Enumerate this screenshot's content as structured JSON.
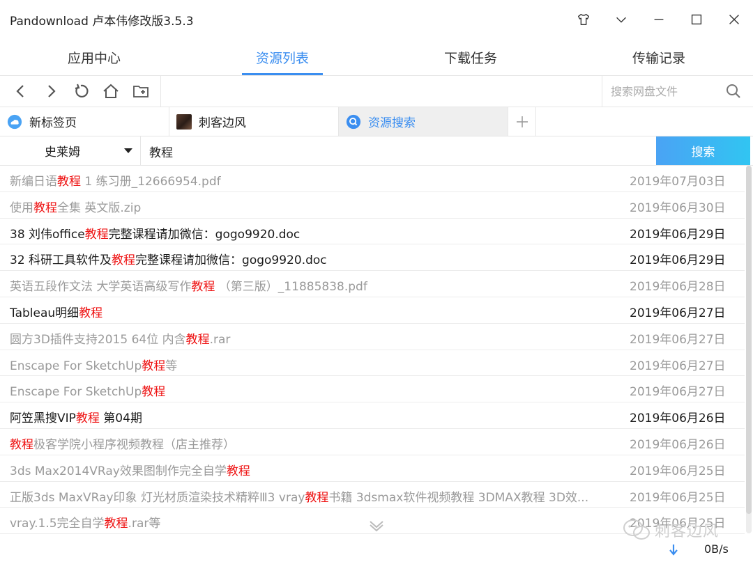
{
  "app": {
    "title": "Pandownload 卢本伟修改版3.5.3"
  },
  "main_nav": {
    "tabs": [
      {
        "label": "应用中心"
      },
      {
        "label": "资源列表"
      },
      {
        "label": "下载任务"
      },
      {
        "label": "传输记录"
      }
    ],
    "active_tab": "资源列表"
  },
  "toolbar": {
    "buttons": [
      "back-icon",
      "forward-icon",
      "refresh-icon",
      "home-icon",
      "new-folder-icon"
    ],
    "search_placeholder": "搜索网盘文件"
  },
  "browser_tabs": [
    {
      "label": "新标签页",
      "icon": "cloud-icon"
    },
    {
      "label": "刺客边风",
      "icon": "avatar"
    },
    {
      "label": "资源搜索",
      "icon": "search-icon",
      "active": true
    }
  ],
  "search_bar": {
    "source": "史莱姆",
    "keyword": "教程",
    "button_label": "搜索"
  },
  "results": [
    {
      "pre": "新编日语",
      "hl": "教程",
      "post": " 1  练习册_12666954.pdf",
      "date": "2019年07月03日",
      "tone": "gray"
    },
    {
      "pre": "使用",
      "hl": "教程",
      "post": "全集 英文版.zip",
      "date": "2019年06月30日",
      "tone": "gray"
    },
    {
      "pre": "38   刘伟office",
      "hl": "教程",
      "post": "完整课程请加微信：gogo9920.doc",
      "date": "2019年06月29日",
      "tone": "dark"
    },
    {
      "pre": "32   科研工具软件及",
      "hl": "教程",
      "post": "完整课程请加微信：gogo9920.doc",
      "date": "2019年06月29日",
      "tone": "dark"
    },
    {
      "pre": "英语五段作文法  大学英语高级写作",
      "hl": "教程",
      "post": " （第三版）_11885838.pdf",
      "date": "2019年06月28日",
      "tone": "gray"
    },
    {
      "pre": "Tableau明细",
      "hl": "教程",
      "post": "",
      "date": "2019年06月27日",
      "tone": "dark"
    },
    {
      "pre": "圆方3D插件支持2015 64位 内含",
      "hl": "教程",
      "post": ".rar",
      "date": "2019年06月27日",
      "tone": "gray"
    },
    {
      "pre": "Enscape For SketchUp",
      "hl": "教程",
      "post": "等",
      "date": "2019年06月27日",
      "tone": "gray"
    },
    {
      "pre": "Enscape For SketchUp",
      "hl": "教程",
      "post": "",
      "date": "2019年06月27日",
      "tone": "gray"
    },
    {
      "pre": "阿笠黑搜VIP",
      "hl": "教程",
      "post": " 第04期",
      "date": "2019年06月26日",
      "tone": "dark"
    },
    {
      "pre": "",
      "hl": "教程",
      "post": "极客学院小程序视频教程（店主推荐）",
      "date": "2019年06月26日",
      "tone": "gray"
    },
    {
      "pre": "3ds Max2014VRay效果图制作完全自学",
      "hl": "教程",
      "post": "",
      "date": "2019年06月25日",
      "tone": "gray"
    },
    {
      "pre": "正版3ds MaxVRay印象 灯光材质渲染技术精粹Ⅲ3 vray",
      "hl": "教程",
      "post": "书籍 3dsmax软件视频教程 3DMAX教程 3D效...",
      "date": "2019年06月25日",
      "tone": "gray"
    },
    {
      "pre": "vray.1.5完全自学",
      "hl": "教程",
      "post": ".rar等",
      "date": "2019年06月25日",
      "tone": "gray"
    }
  ],
  "watermark": "刺客边风",
  "status": {
    "speed": "0B/s"
  },
  "colors": {
    "accent": "#3b8ef0",
    "highlight": "#ee1111",
    "muted_text": "#9a9a9a"
  }
}
